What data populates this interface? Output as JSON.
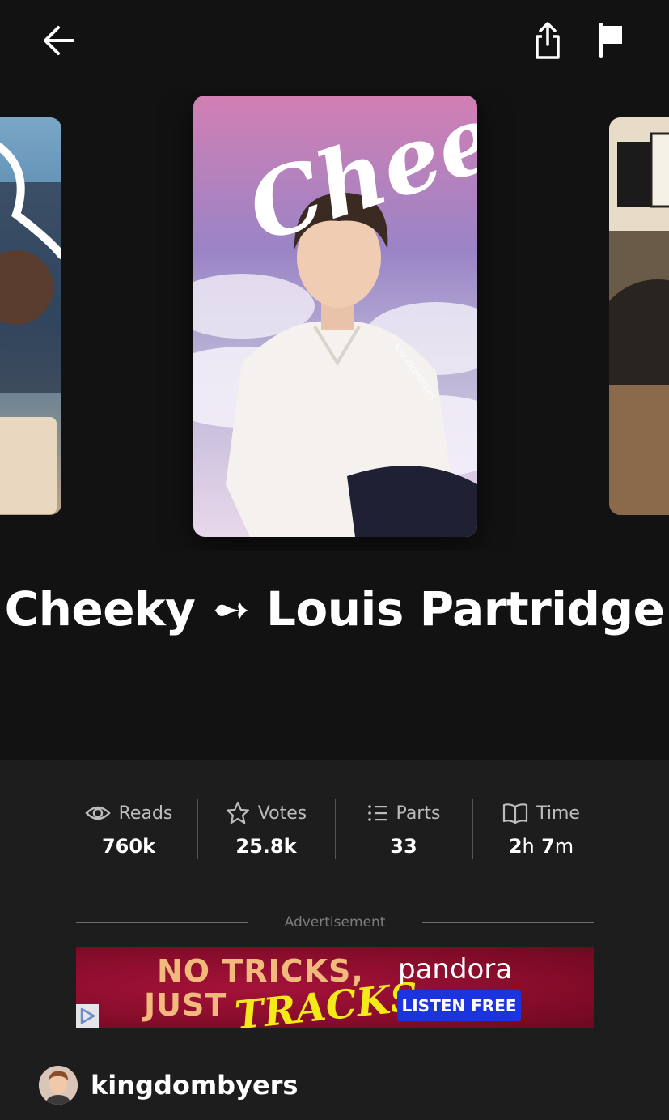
{
  "story": {
    "title": "Cheeky ➻ Louis Partridge",
    "cover_text": "Cheeky",
    "cover_watermark": "KINGDOMBYERS"
  },
  "stats": [
    {
      "label": "Reads",
      "value": "760k",
      "icon": "eye-icon"
    },
    {
      "label": "Votes",
      "value": "25.8k",
      "icon": "star-icon"
    },
    {
      "label": "Parts",
      "value": "33",
      "icon": "list-icon"
    },
    {
      "label": "Time",
      "value_h": "2",
      "unit_h": "h",
      "value_m": "7",
      "unit_m": "m",
      "icon": "book-icon"
    }
  ],
  "ad": {
    "label": "Advertisement",
    "line1": "NO TRICKS,",
    "line2": "JUST",
    "highlight": "TRACKS",
    "brand": "pandora",
    "cta": "LISTEN FREE"
  },
  "author": {
    "name": "kingdombyers"
  },
  "colors": {
    "background": "#121212",
    "panel": "#1d1d1d",
    "ad_bg": "#8a0d2c",
    "ad_text": "#f2b97c",
    "ad_cta": "#1c33e0"
  }
}
